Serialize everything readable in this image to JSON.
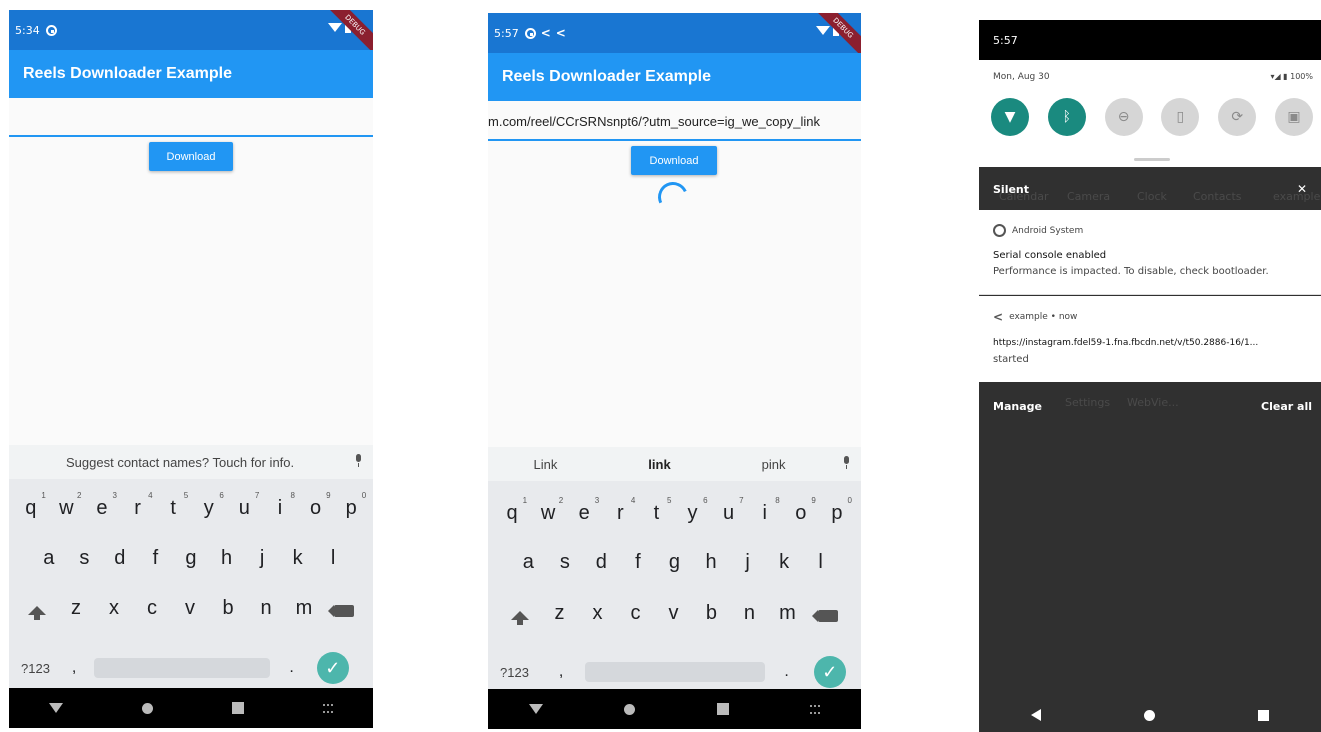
{
  "phone1": {
    "time": "5:34",
    "debug_banner": "DEBUG",
    "app_title": "Reels Downloader Example",
    "url_value": "",
    "download_label": "Download",
    "suggestion": "Suggest contact names? Touch for info.",
    "num_key": "?123",
    "comma": ",",
    "period": "."
  },
  "phone2": {
    "time": "5:57",
    "debug_banner": "DEBUG",
    "app_title": "Reels Downloader Example",
    "url_value": "m.com/reel/CCrSRNsnpt6/?utm_source=ig_we_copy_link",
    "download_label": "Download",
    "suggestions": [
      "Link",
      "link",
      "pink"
    ],
    "num_key": "?123",
    "comma": ",",
    "period": "."
  },
  "keyboard": {
    "row1": [
      {
        "k": "q",
        "n": "1"
      },
      {
        "k": "w",
        "n": "2"
      },
      {
        "k": "e",
        "n": "3"
      },
      {
        "k": "r",
        "n": "4"
      },
      {
        "k": "t",
        "n": "5"
      },
      {
        "k": "y",
        "n": "6"
      },
      {
        "k": "u",
        "n": "7"
      },
      {
        "k": "i",
        "n": "8"
      },
      {
        "k": "o",
        "n": "9"
      },
      {
        "k": "p",
        "n": "0"
      }
    ],
    "row2": [
      "a",
      "s",
      "d",
      "f",
      "g",
      "h",
      "j",
      "k",
      "l"
    ],
    "row3": [
      "z",
      "x",
      "c",
      "v",
      "b",
      "n",
      "m"
    ]
  },
  "phone3": {
    "time": "5:57",
    "date": "Mon, Aug 30",
    "battery": "100%",
    "silent_label": "Silent",
    "ghost_apps": [
      "Calendar",
      "Camera",
      "Clock",
      "Contacts",
      "example"
    ],
    "notif1": {
      "app": "Android System",
      "title": "Serial console enabled",
      "body": "Performance is impacted. To disable, check bootloader."
    },
    "notif2": {
      "app": "example • now",
      "url": "https://instagram.fdel59-1.fna.fbcdn.net/v/t50.2886-16/1...",
      "status": "started"
    },
    "ghost_apps2": [
      "Settings",
      "WebVie..."
    ],
    "manage_label": "Manage",
    "clear_all_label": "Clear all"
  },
  "colors": {
    "status_bar": "#1976d2",
    "app_bar": "#2196f3",
    "teal_tile": "#1a8a7f",
    "check_button": "#4db6ac"
  }
}
